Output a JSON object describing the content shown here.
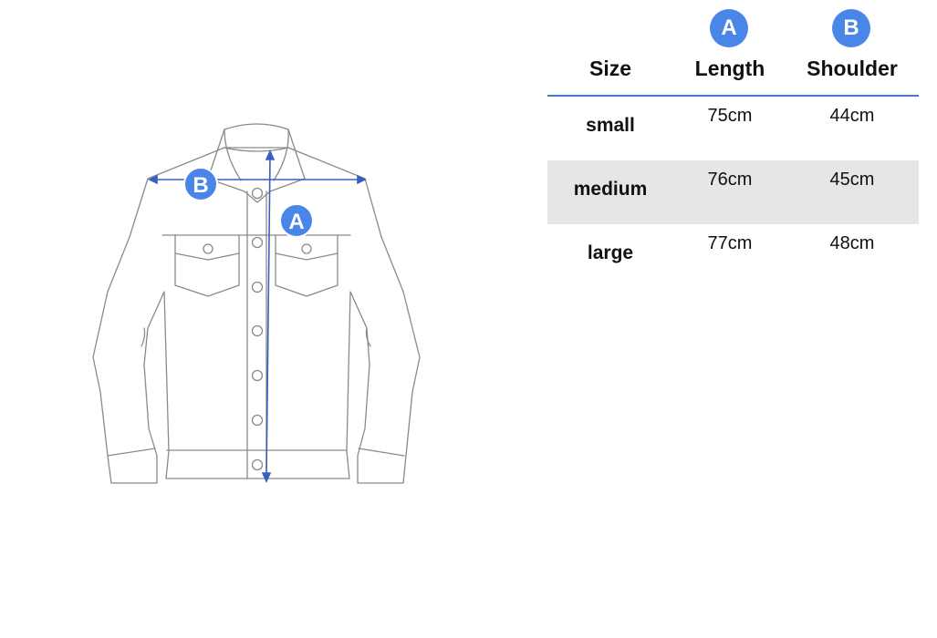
{
  "diagram": {
    "badge_a": "A",
    "badge_b": "B",
    "accent_color": "#4a86e8",
    "line_color": "#3b5fc0"
  },
  "table": {
    "headers": {
      "size": "Size",
      "length": "Length",
      "shoulder": "Shoulder",
      "length_badge": "A",
      "shoulder_badge": "B"
    },
    "rows": [
      {
        "size": "small",
        "length": "75cm",
        "shoulder": "44cm"
      },
      {
        "size": "medium",
        "length": "76cm",
        "shoulder": "45cm"
      },
      {
        "size": "large",
        "length": "77cm",
        "shoulder": "48cm"
      }
    ]
  }
}
